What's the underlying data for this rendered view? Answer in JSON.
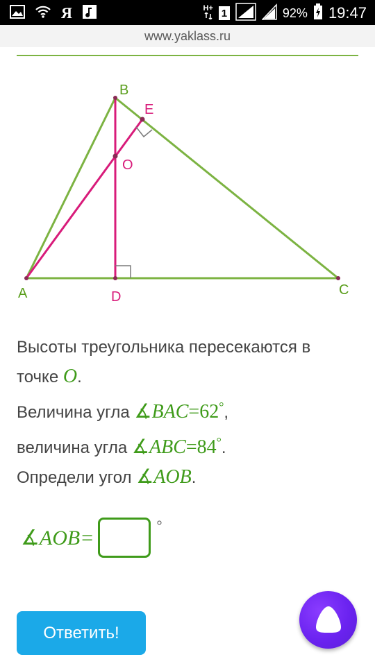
{
  "status_bar": {
    "carrier_letter": "Я",
    "network_type": "H+",
    "sim_slot": "1",
    "battery": "92%",
    "time": "19:47"
  },
  "browser": {
    "url": "www.yaklass.ru"
  },
  "diagram": {
    "points": [
      "A",
      "B",
      "C",
      "D",
      "E",
      "O"
    ],
    "colors": {
      "triangle": "#7cb342",
      "altitudes": "#d81b7a",
      "label_green": "#5a9e1c",
      "label_magenta": "#d81b7a"
    }
  },
  "problem": {
    "line1": "Высоты треугольника пересекаются в",
    "line2_prefix": "точке ",
    "point_O": "O",
    "line3_prefix": "Величина угла ",
    "angle1_name": "BAC",
    "angle1_value": "=62",
    "line4_prefix": "величина угла ",
    "angle2_name": "ABC",
    "angle2_value": "=84",
    "line5_prefix": "Определи угол ",
    "target_angle": "AOB",
    "angle_symbol": "∡",
    "degree": "°",
    "comma": ",",
    "dot": "."
  },
  "answer": {
    "expression": "AOB=",
    "value": "",
    "unit": "°"
  },
  "buttons": {
    "submit_label": "Ответить!"
  },
  "colors": {
    "accent_green": "#3f9b1a",
    "submit_blue": "#1ba9e8",
    "assistant_purple": "#6b23f0"
  }
}
